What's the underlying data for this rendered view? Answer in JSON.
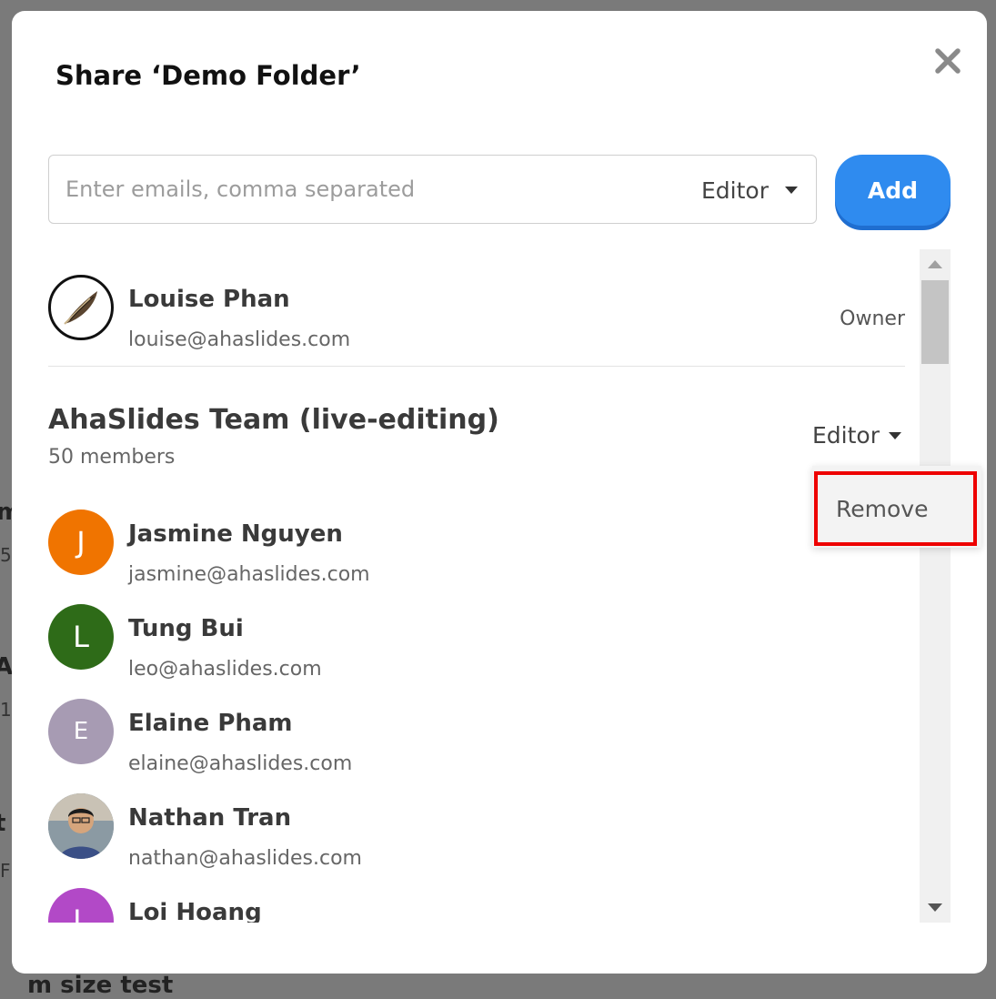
{
  "background": {
    "fragments": [
      "m",
      "5",
      "A",
      "1",
      "t",
      "F",
      "m size test"
    ]
  },
  "dialog": {
    "title": "Share ‘Demo Folder’",
    "close_icon": "close-icon"
  },
  "invite": {
    "placeholder": "Enter emails, comma separated",
    "value": "",
    "role": "Editor",
    "add_label": "Add"
  },
  "owner": {
    "name": "Louise Phan",
    "email": "louise@ahaslides.com",
    "role": "Owner",
    "avatar_icon": "feather-avatar-icon"
  },
  "team": {
    "name": "AhaSlides Team (live-editing)",
    "members_count": "50 members",
    "role": "Editor"
  },
  "role_menu": {
    "items": [
      "Remove"
    ]
  },
  "members": [
    {
      "initial": "J",
      "name": "Jasmine Nguyen",
      "email": "jasmine@ahaslides.com",
      "color": "#f07400"
    },
    {
      "initial": "L",
      "name": "Tung Bui",
      "email": "leo@ahaslides.com",
      "color": "#2e6b18"
    },
    {
      "initial": "E",
      "name": "Elaine Pham",
      "email": "elaine@ahaslides.com",
      "color": "#a79bb3"
    },
    {
      "initial": "",
      "name": "Nathan Tran",
      "email": "nathan@ahaslides.com",
      "color": "#6b7b86"
    },
    {
      "initial": "L",
      "name": "Loi Hoang",
      "email": "",
      "color": "#b249c7"
    }
  ],
  "colors": {
    "accent": "#2f8bef",
    "highlight": "#ee0000"
  }
}
